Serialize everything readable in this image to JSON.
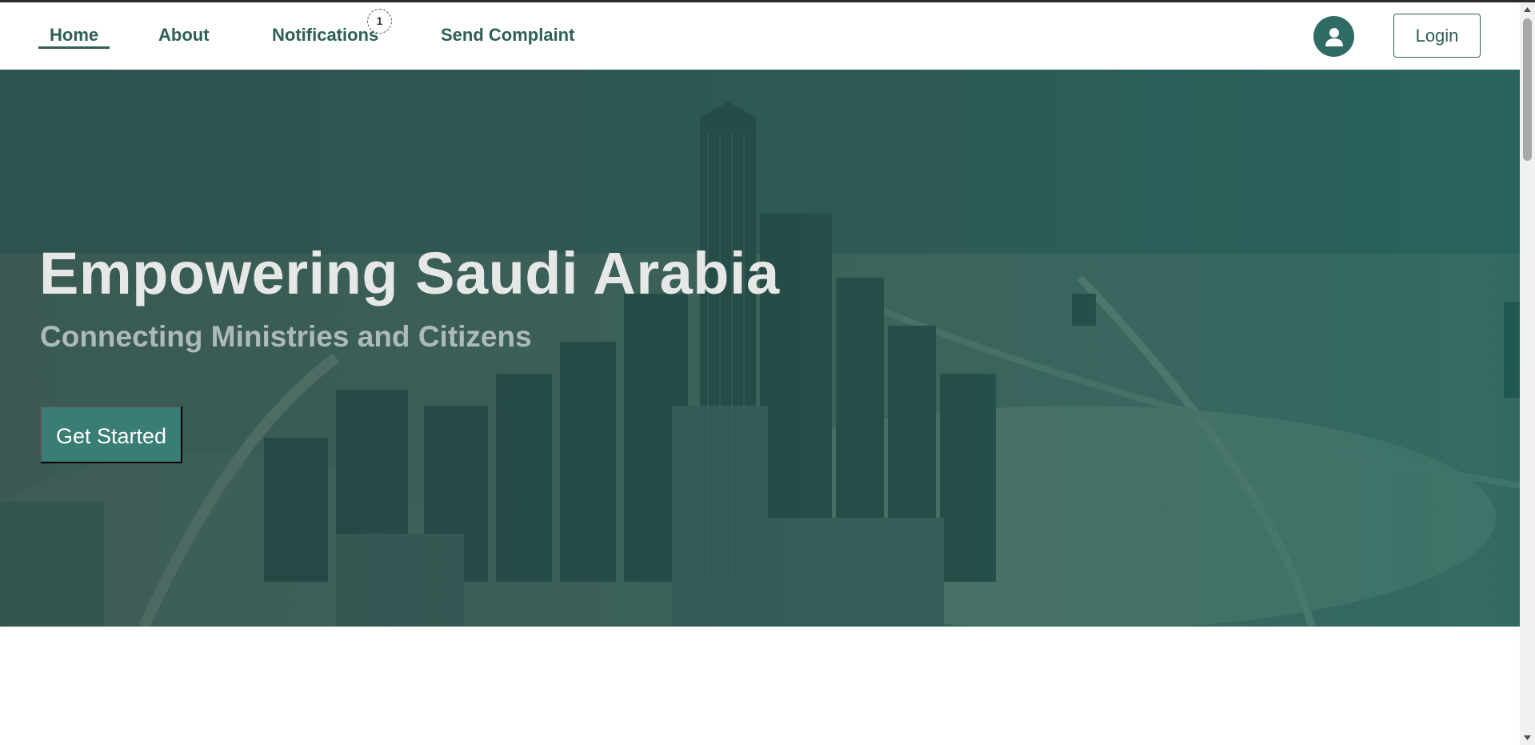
{
  "navbar": {
    "items": [
      {
        "label": "Home",
        "active": true
      },
      {
        "label": "About",
        "active": false
      },
      {
        "label": "Notifications",
        "active": false
      },
      {
        "label": "Send Complaint",
        "active": false
      }
    ],
    "notification_count": "1",
    "login_label": "Login",
    "avatar_icon": "user-icon"
  },
  "hero": {
    "title": "Empowering Saudi Arabia",
    "subtitle": "Connecting Ministries and Citizens",
    "cta_label": "Get Started",
    "background": "city-skyline-image"
  },
  "colors": {
    "brand": "#2f5f58",
    "accent": "#3a7d75",
    "hero_overlay": "#1c5a54"
  }
}
